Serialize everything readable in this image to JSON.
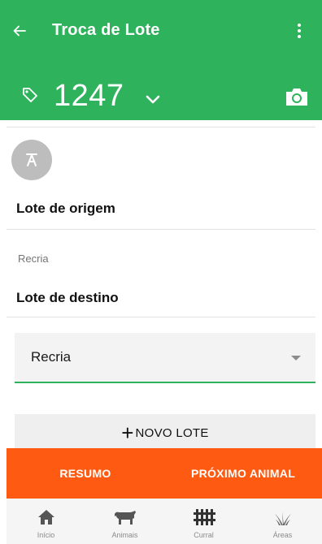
{
  "app": {
    "title": "Troca de Lote"
  },
  "animal": {
    "id": "1247"
  },
  "sections": {
    "origin_label": "Lote de origem",
    "origin_value": "Recria",
    "destination_label": "Lote de destino",
    "destination_select_value": "Recria",
    "new_lot_plus": "+",
    "new_lot_button": "NOVO LOTE"
  },
  "actions": {
    "summary": "RESUMO",
    "next_animal": "PRÓXIMO ANIMAL"
  },
  "nav": [
    {
      "label": "Início",
      "icon": "home-icon"
    },
    {
      "label": "Animais",
      "icon": "cow-icon"
    },
    {
      "label": "Curral",
      "icon": "fence-icon"
    },
    {
      "label": "Áreas",
      "icon": "grass-icon"
    }
  ],
  "colors": {
    "header": "#2eb35c",
    "accent": "#ff5a12",
    "select_underline": "#2eb35c"
  }
}
